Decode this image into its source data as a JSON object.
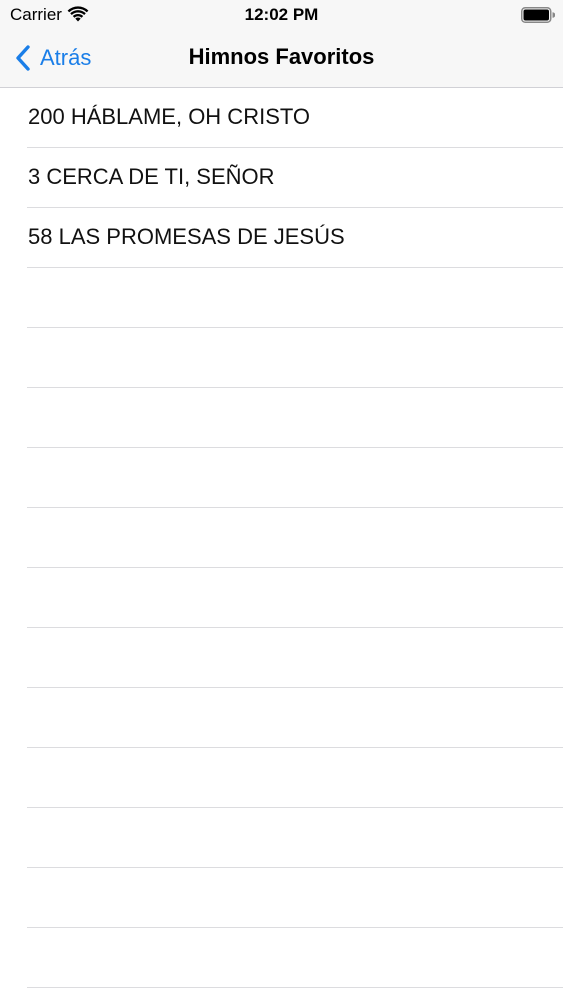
{
  "status_bar": {
    "carrier": "Carrier",
    "time": "12:02 PM",
    "icons": [
      "wifi-icon",
      "battery-icon"
    ]
  },
  "nav": {
    "back_label": "Atrás",
    "title": "Himnos Favoritos",
    "accent_color": "#1a7ee8"
  },
  "hymns": [
    {
      "label": "200 HÁBLAME, OH CRISTO"
    },
    {
      "label": "3 CERCA DE TI, SEÑOR"
    },
    {
      "label": "58 LAS PROMESAS DE JESÚS"
    }
  ]
}
